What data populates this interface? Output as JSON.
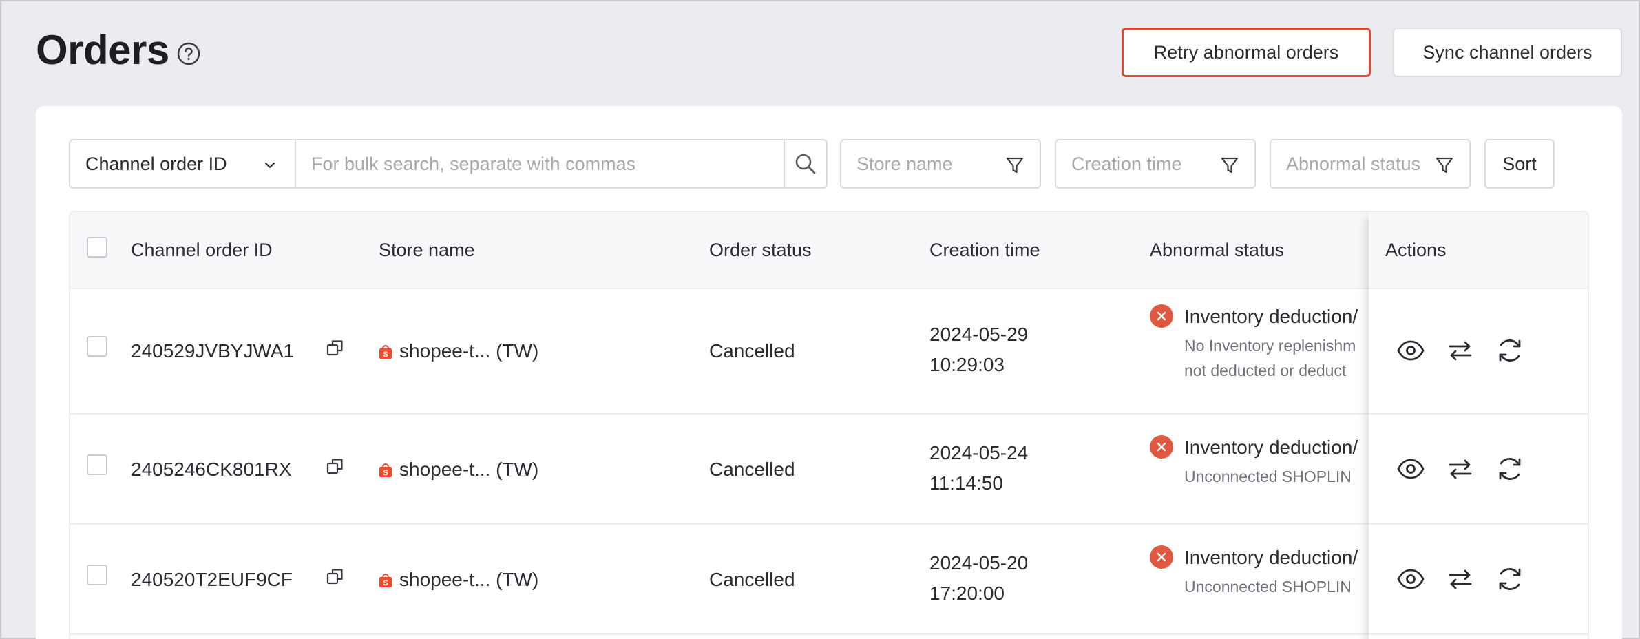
{
  "header": {
    "title": "Orders",
    "retry_label": "Retry abnormal orders",
    "sync_label": "Sync channel orders"
  },
  "filters": {
    "search_type": "Channel order ID",
    "search_placeholder": "For bulk search, separate with commas",
    "store_name": "Store name",
    "creation_time": "Creation time",
    "abnormal_status": "Abnormal status",
    "sort": "Sort"
  },
  "table": {
    "columns": {
      "channel_order_id": "Channel order ID",
      "store_name": "Store name",
      "order_status": "Order status",
      "creation_time": "Creation time",
      "abnormal_status": "Abnormal status",
      "actions": "Actions"
    },
    "rows": [
      {
        "order_id": "240529JVBYJWA1",
        "store": "shopee-t... (TW)",
        "status": "Cancelled",
        "date": "2024-05-29",
        "time": "10:29:03",
        "abnormal_title": "Inventory deduction/",
        "abnormal_desc_1": "No Inventory replenishm",
        "abnormal_desc_2": "not deducted or deduct"
      },
      {
        "order_id": "2405246CK801RX",
        "store": "shopee-t... (TW)",
        "status": "Cancelled",
        "date": "2024-05-24",
        "time": "11:14:50",
        "abnormal_title": "Inventory deduction/",
        "abnormal_desc_1": "Unconnected SHOPLIN"
      },
      {
        "order_id": "240520T2EUF9CF",
        "store": "shopee-t... (TW)",
        "status": "Cancelled",
        "date": "2024-05-20",
        "time": "17:20:00",
        "abnormal_title": "Inventory deduction/",
        "abnormal_desc_1": "Unconnected SHOPLIN"
      }
    ]
  },
  "colors": {
    "accent_red": "#d84a35",
    "error_icon": "#e0583f",
    "shopee_orange": "#ee4d2d"
  },
  "icons": {
    "help": "help-circle-icon",
    "search": "search-icon",
    "filter": "filter-icon",
    "copy": "copy-icon",
    "store": "shopee-bag-icon",
    "error": "close-circle-icon",
    "view": "eye-icon",
    "swap": "swap-arrows-icon",
    "sync": "sync-icon"
  }
}
